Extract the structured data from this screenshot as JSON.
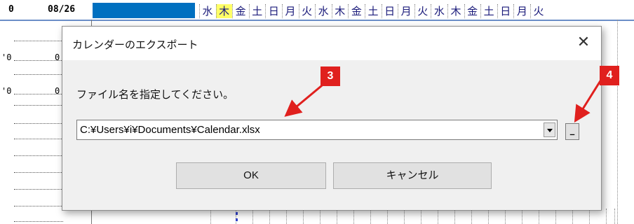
{
  "sheet": {
    "left_header": "0",
    "date_label": "08/26",
    "days": [
      "水",
      "木",
      "金",
      "土",
      "日",
      "月",
      "火",
      "水",
      "木",
      "金",
      "土",
      "日",
      "月",
      "火",
      "水",
      "木",
      "金",
      "土",
      "日",
      "月",
      "火"
    ],
    "today_index": 1,
    "row_labels": [
      {
        "left": "'0",
        "right": "0"
      },
      {
        "left": "'0",
        "right": "0"
      }
    ]
  },
  "dialog": {
    "title": "カレンダーのエクスポート",
    "close_glyph": "✕",
    "prompt": "ファイル名を指定してください。",
    "file_path_value": "C:¥Users¥i¥Documents¥Calendar.xlsx",
    "browse_label": "_",
    "ok_label": "OK",
    "cancel_label": "キャンセル"
  },
  "annotations": {
    "badge_3": "3",
    "badge_4": "4",
    "color": "#e0201e"
  }
}
